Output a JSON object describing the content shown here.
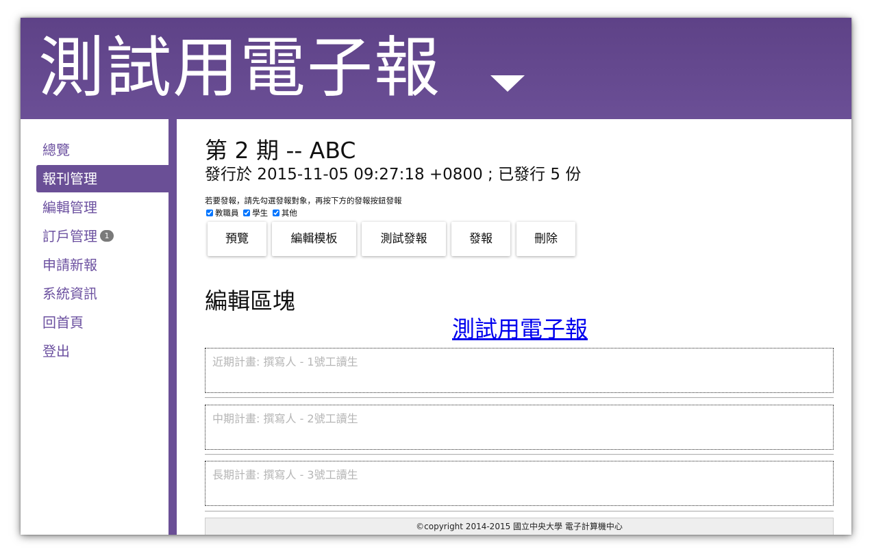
{
  "header": {
    "title": "測試用電子報"
  },
  "sidebar": {
    "items": [
      {
        "label": "總覽"
      },
      {
        "label": "報刊管理"
      },
      {
        "label": "編輯管理"
      },
      {
        "label": "訂戶管理",
        "badge": "1"
      },
      {
        "label": "申請新報"
      },
      {
        "label": "系統資訊"
      },
      {
        "label": "回首頁"
      },
      {
        "label": "登出"
      }
    ],
    "active_index": 1
  },
  "issue": {
    "title": "第 2 期 -- ABC",
    "meta": "發行於 2015-11-05 09:27:18 +0800 ; 已發行 5 份",
    "send_hint": "若要發報，請先勾選發報對象，再按下方的發報按鈕發報",
    "targets": [
      {
        "label": "教職員",
        "checked": true
      },
      {
        "label": "學生",
        "checked": true
      },
      {
        "label": "其他",
        "checked": true
      }
    ]
  },
  "actions": {
    "preview": "預覽",
    "edit_template": "編輯模板",
    "test_send": "測試發報",
    "send": "發報",
    "delete": "刪除"
  },
  "editor": {
    "section_title": "編輯區塊",
    "template_link": "測試用電子報",
    "blocks": [
      {
        "placeholder": "近期計畫: 撰寫人 - 1號工讀生"
      },
      {
        "placeholder": "中期計畫: 撰寫人 - 2號工讀生"
      },
      {
        "placeholder": "長期計畫: 撰寫人 - 3號工讀生"
      }
    ]
  },
  "footer": {
    "text": "©copyright 2014-2015 國立中央大學 電子計算機中心"
  },
  "colors": {
    "header_bg": "#5e4287",
    "accent": "#6a4f96",
    "nav_text": "#6c51a0",
    "link": "#0000ee"
  }
}
